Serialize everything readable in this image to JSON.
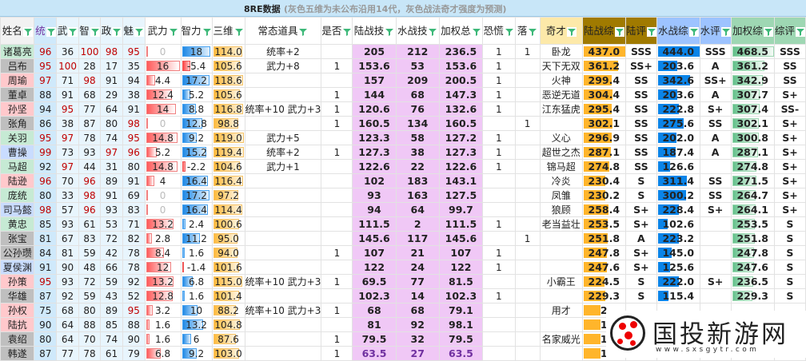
{
  "title": "8RE数据",
  "note": "(灰色五维为未公布沿用14代，灰色战法奇才强度为预测)",
  "headers": [
    "姓名",
    "统",
    "武",
    "智",
    "政",
    "魅",
    "武力",
    "智力",
    "三维",
    "常态道具",
    "是否",
    "陆战技",
    "水战技",
    "加权总",
    "恐慌",
    "落",
    "奇才",
    "陆战综",
    "陆评",
    "水战综",
    "水评",
    "加权综",
    "综评"
  ],
  "colors": {
    "shu": "#c6ead4",
    "qun": "#bfbfbf",
    "wu": "#ffc9cc",
    "wei": "#c9dcff",
    "land": "#ffb52b",
    "water": "#0a84e8",
    "weighted": "#63c08a",
    "str_bar": "#ff5a5a",
    "int_bar": "#1e88e5",
    "sanwei_bar": "#ffbb3d",
    "pink_col": "#f0c8f6"
  },
  "rows": [
    {
      "name": "诸葛亮",
      "k": "shu",
      "s": [
        96,
        36,
        100,
        98,
        95
      ],
      "str": "0",
      "int": "18",
      "sw": "114.0",
      "item": "统率+2",
      "yes": "",
      "lt": "205",
      "wt": "212",
      "wsum": "236.5",
      "panic": "1",
      "luo": "1",
      "qc": "卧龙",
      "lz": "437.0",
      "lp": "SSS",
      "sz": "444.0",
      "sp": "SSS",
      "jz": "468.5",
      "zp": "SSS"
    },
    {
      "name": "吕布",
      "k": "qun",
      "s": [
        95,
        100,
        28,
        17,
        35
      ],
      "str": "16",
      "int": "-5.4",
      "sw": "105.6",
      "item": "武力+8",
      "yes": "1",
      "lt": "153.6",
      "wt": "53",
      "wsum": "153.6",
      "panic": "1",
      "luo": "",
      "qc": "天下无双",
      "lz": "361.2",
      "lp": "SS+",
      "sz": "203.6",
      "sp": "A",
      "jz": "361.2",
      "zp": "SS"
    },
    {
      "name": "周瑜",
      "k": "wu",
      "s": [
        97,
        71,
        98,
        91,
        94
      ],
      "str": "4.4",
      "int": "17.2",
      "sw": "118.6",
      "item": "",
      "yes": "",
      "lt": "157",
      "wt": "209",
      "wsum": "200.5",
      "panic": "1",
      "luo": "",
      "qc": "火神",
      "lz": "299.4",
      "lp": "SS",
      "sz": "342.6",
      "sp": "SS+",
      "jz": "342.9",
      "zp": "SS"
    },
    {
      "name": "董卓",
      "k": "qun",
      "s": [
        88,
        91,
        68,
        29,
        38
      ],
      "str": "12.4",
      "int": "5.2",
      "sw": "105.6",
      "item": "",
      "yes": "1",
      "lt": "144",
      "wt": "68",
      "wsum": "147.3",
      "panic": "1",
      "luo": "",
      "qc": "恶逆无道",
      "lz": "304.4",
      "lp": "SS",
      "sz": "203.6",
      "sp": "A",
      "jz": "307.7",
      "zp": "S+"
    },
    {
      "name": "孙坚",
      "k": "wu",
      "s": [
        94,
        95,
        77,
        64,
        91
      ],
      "str": "14",
      "int": "8.8",
      "sw": "116.8",
      "item": "统率+10 武力+3",
      "yes": "1",
      "lt": "120.6",
      "wt": "76",
      "wsum": "132.6",
      "panic": "1",
      "luo": "",
      "qc": "江东猛虎",
      "lz": "295.4",
      "lp": "SS",
      "sz": "222.8",
      "sp": "S+",
      "jz": "307.4",
      "zp": "SS-"
    },
    {
      "name": "张角",
      "k": "qun",
      "s": [
        86,
        38,
        87,
        80,
        98
      ],
      "str": "0",
      "int": "12.8",
      "sw": "98.8",
      "item": "",
      "yes": "1",
      "lt": "160.5",
      "wt": "134",
      "wsum": "160.5",
      "panic": "",
      "luo": "1",
      "qc": "",
      "lz": "302.1",
      "lp": "SS",
      "sz": "275.6",
      "sp": "SS",
      "jz": "302.1",
      "zp": "S+"
    },
    {
      "name": "关羽",
      "k": "shu",
      "s": [
        95,
        97,
        78,
        74,
        95
      ],
      "str": "14.8",
      "int": "9.2",
      "sw": "119.0",
      "item": "武力+5",
      "yes": "",
      "lt": "123.3",
      "wt": "58",
      "wsum": "127.2",
      "panic": "1",
      "luo": "",
      "qc": "义心",
      "lz": "296.9",
      "lp": "SS",
      "sz": "202.0",
      "sp": "A",
      "jz": "300.8",
      "zp": "S+"
    },
    {
      "name": "曹操",
      "k": "wei",
      "s": [
        99,
        73,
        93,
        97,
        96
      ],
      "str": "5.2",
      "int": "15.2",
      "sw": "119.4",
      "item": "统率+2",
      "yes": "1",
      "lt": "127.3",
      "wt": "38",
      "wsum": "127.3",
      "panic": "1",
      "luo": "",
      "qc": "超世之杰",
      "lz": "287.1",
      "lp": "SS",
      "sz": "187.4",
      "sp": "A",
      "jz": "287.1",
      "zp": "S+"
    },
    {
      "name": "马超",
      "k": "shu",
      "s": [
        92,
        97,
        44,
        31,
        80
      ],
      "str": "14.8",
      "int": "-2.2",
      "sw": "104.6",
      "item": "武力+1",
      "yes": "",
      "lt": "122.6",
      "wt": "22",
      "wsum": "122.6",
      "panic": "1",
      "luo": "",
      "qc": "锦马超",
      "lz": "274.8",
      "lp": "SS",
      "sz": "126.6",
      "sp": "",
      "jz": "274.8",
      "zp": "S+"
    },
    {
      "name": "陆逊",
      "k": "wu",
      "s": [
        96,
        70,
        96,
        89,
        91
      ],
      "str": "4",
      "int": "16.4",
      "sw": "116.4",
      "item": "",
      "yes": "",
      "lt": "102",
      "wt": "183",
      "wsum": "143.1",
      "panic": "",
      "luo": "",
      "qc": "冷炎",
      "lz": "230.4",
      "lp": "S",
      "sz": "311.4",
      "sp": "SS",
      "jz": "271.5",
      "zp": "S+"
    },
    {
      "name": "庞统",
      "k": "shu",
      "s": [
        80,
        33,
        98,
        91,
        69
      ],
      "str": "0",
      "int": "17.2",
      "sw": "97.2",
      "item": "",
      "yes": "",
      "lt": "93",
      "wt": "163",
      "wsum": "127.5",
      "panic": "",
      "luo": "",
      "qc": "凤雏",
      "lz": "230.2",
      "lp": "S",
      "sz": "300.2",
      "sp": "SS",
      "jz": "264.7",
      "zp": "S+"
    },
    {
      "name": "司马懿",
      "k": "wei",
      "s": [
        98,
        57,
        96,
        93,
        83
      ],
      "str": "0",
      "int": "16.4",
      "sw": "114.4",
      "item": "",
      "yes": "",
      "lt": "94",
      "wt": "64",
      "wsum": "99.7",
      "panic": "",
      "luo": "",
      "qc": "狼顾",
      "lz": "258.4",
      "lp": "S+",
      "sz": "228.4",
      "sp": "S+",
      "jz": "264.1",
      "zp": "S+"
    },
    {
      "name": "黄忠",
      "k": "shu",
      "s": [
        85,
        93,
        61,
        53,
        71
      ],
      "str": "13.2",
      "int": "2.4",
      "sw": "100.6",
      "item": "",
      "yes": "",
      "lt": "111.5",
      "wt": "2",
      "wsum": "111.5",
      "panic": "1",
      "luo": "",
      "qc": "老当益壮",
      "lz": "253.5",
      "lp": "S+",
      "sz": "102.6",
      "sp": "",
      "jz": "253.5",
      "zp": "S"
    },
    {
      "name": "张宝",
      "k": "qun",
      "s": [
        81,
        67,
        83,
        72,
        82
      ],
      "str": "2.8",
      "int": "11.2",
      "sw": "95.0",
      "item": "",
      "yes": "",
      "lt": "145.6",
      "wt": "117",
      "wsum": "145.6",
      "panic": "",
      "luo": "1",
      "qc": "",
      "lz": "251.8",
      "lp": "A",
      "sz": "223.2",
      "sp": "",
      "jz": "251.8",
      "zp": "S"
    },
    {
      "name": "公孙瓒",
      "k": "qun",
      "s": [
        84,
        81,
        59,
        42,
        78
      ],
      "str": "8.4",
      "int": "1.6",
      "sw": "94.0",
      "item": "",
      "yes": "1",
      "lt": "107",
      "wt": "21",
      "wsum": "107",
      "panic": "1",
      "luo": "",
      "qc": "",
      "lz": "247.8",
      "lp": "S+",
      "sz": "145.0",
      "sp": "",
      "jz": "247.8",
      "zp": "S"
    },
    {
      "name": "夏侯渊",
      "k": "wei",
      "s": [
        91,
        90,
        48,
        66,
        78
      ],
      "str": "12",
      "int": "-1.4",
      "sw": "101.6",
      "item": "",
      "yes": "",
      "lt": "122",
      "wt": "24",
      "wsum": "122",
      "panic": "1",
      "luo": "",
      "qc": "",
      "lz": "247.6",
      "lp": "S+",
      "sz": "125.6",
      "sp": "",
      "jz": "247.6",
      "zp": "S"
    },
    {
      "name": "孙策",
      "k": "wu",
      "s": [
        95,
        93,
        72,
        59,
        92
      ],
      "str": "13.2",
      "int": "6.8",
      "sw": "115.0",
      "item": "统率+10 武力+3",
      "yes": "1",
      "lt": "69.5",
      "wt": "77",
      "wsum": "81.5",
      "panic": "",
      "luo": "",
      "qc": "小霸王",
      "lz": "224.5",
      "lp": "S",
      "sz": "222.0",
      "sp": "S+",
      "jz": "236.5",
      "zp": "S"
    },
    {
      "name": "华雄",
      "k": "qun",
      "s": [
        87,
        92,
        59,
        43,
        52
      ],
      "str": "12.8",
      "int": "1.6",
      "sw": "101.4",
      "item": "",
      "yes": "",
      "lt": "102.3",
      "wt": "14",
      "wsum": "102.3",
      "panic": "1",
      "luo": "",
      "qc": "",
      "lz": "229.3",
      "lp": "S",
      "sz": "115.4",
      "sp": "",
      "jz": "229.3",
      "zp": "S"
    },
    {
      "name": "孙权",
      "k": "wu",
      "s": [
        75,
        68,
        80,
        89,
        95
      ],
      "str": "3.2",
      "int": "10",
      "sw": "88.2",
      "item": "统率+10 武力+3",
      "yes": "1",
      "lt": "68",
      "wt": "68",
      "wsum": "79.1",
      "panic": "",
      "luo": "",
      "qc": "用才",
      "lz": "2",
      "lp": "",
      "sz": "",
      "sp": "",
      "jz": "",
      "zp": ""
    },
    {
      "name": "陆抗",
      "k": "wu",
      "s": [
        90,
        64,
        88,
        85,
        88
      ],
      "str": "1.6",
      "int": "13.2",
      "sw": "104.8",
      "item": "",
      "yes": "",
      "lt": "81",
      "wt": "92",
      "wsum": "98.1",
      "panic": "",
      "luo": "",
      "qc": "",
      "lz": "1",
      "lp": "",
      "sz": "",
      "sp": "",
      "jz": "",
      "zp": ""
    },
    {
      "name": "袁绍",
      "k": "qun",
      "s": [
        80,
        64,
        70,
        74,
        90
      ],
      "str": "1.6",
      "int": "6",
      "sw": "87.6",
      "item": "",
      "yes": "1",
      "lt": "79.5",
      "wt": "32",
      "wsum": "79.5",
      "panic": "",
      "luo": "",
      "qc": "名家威光",
      "lz": "1",
      "lp": "",
      "sz": "",
      "sp": "",
      "jz": "",
      "zp": ""
    },
    {
      "name": "韩遂",
      "k": "qun",
      "s": [
        87,
        77,
        78,
        61,
        79
      ],
      "str": "6.8",
      "int": "9.2",
      "sw": "103.0",
      "item": "",
      "yes": "1",
      "lt": "63.5",
      "wt": "27",
      "wsum": "63.5",
      "panic": "",
      "luo": "",
      "qc": "",
      "lz": "1",
      "lp": "",
      "sz": "",
      "sp": "",
      "jz": "",
      "zp": "",
      "purple": true
    }
  ],
  "watermark": {
    "name": "国投新游网",
    "url": "www.sxsgytr.com"
  }
}
